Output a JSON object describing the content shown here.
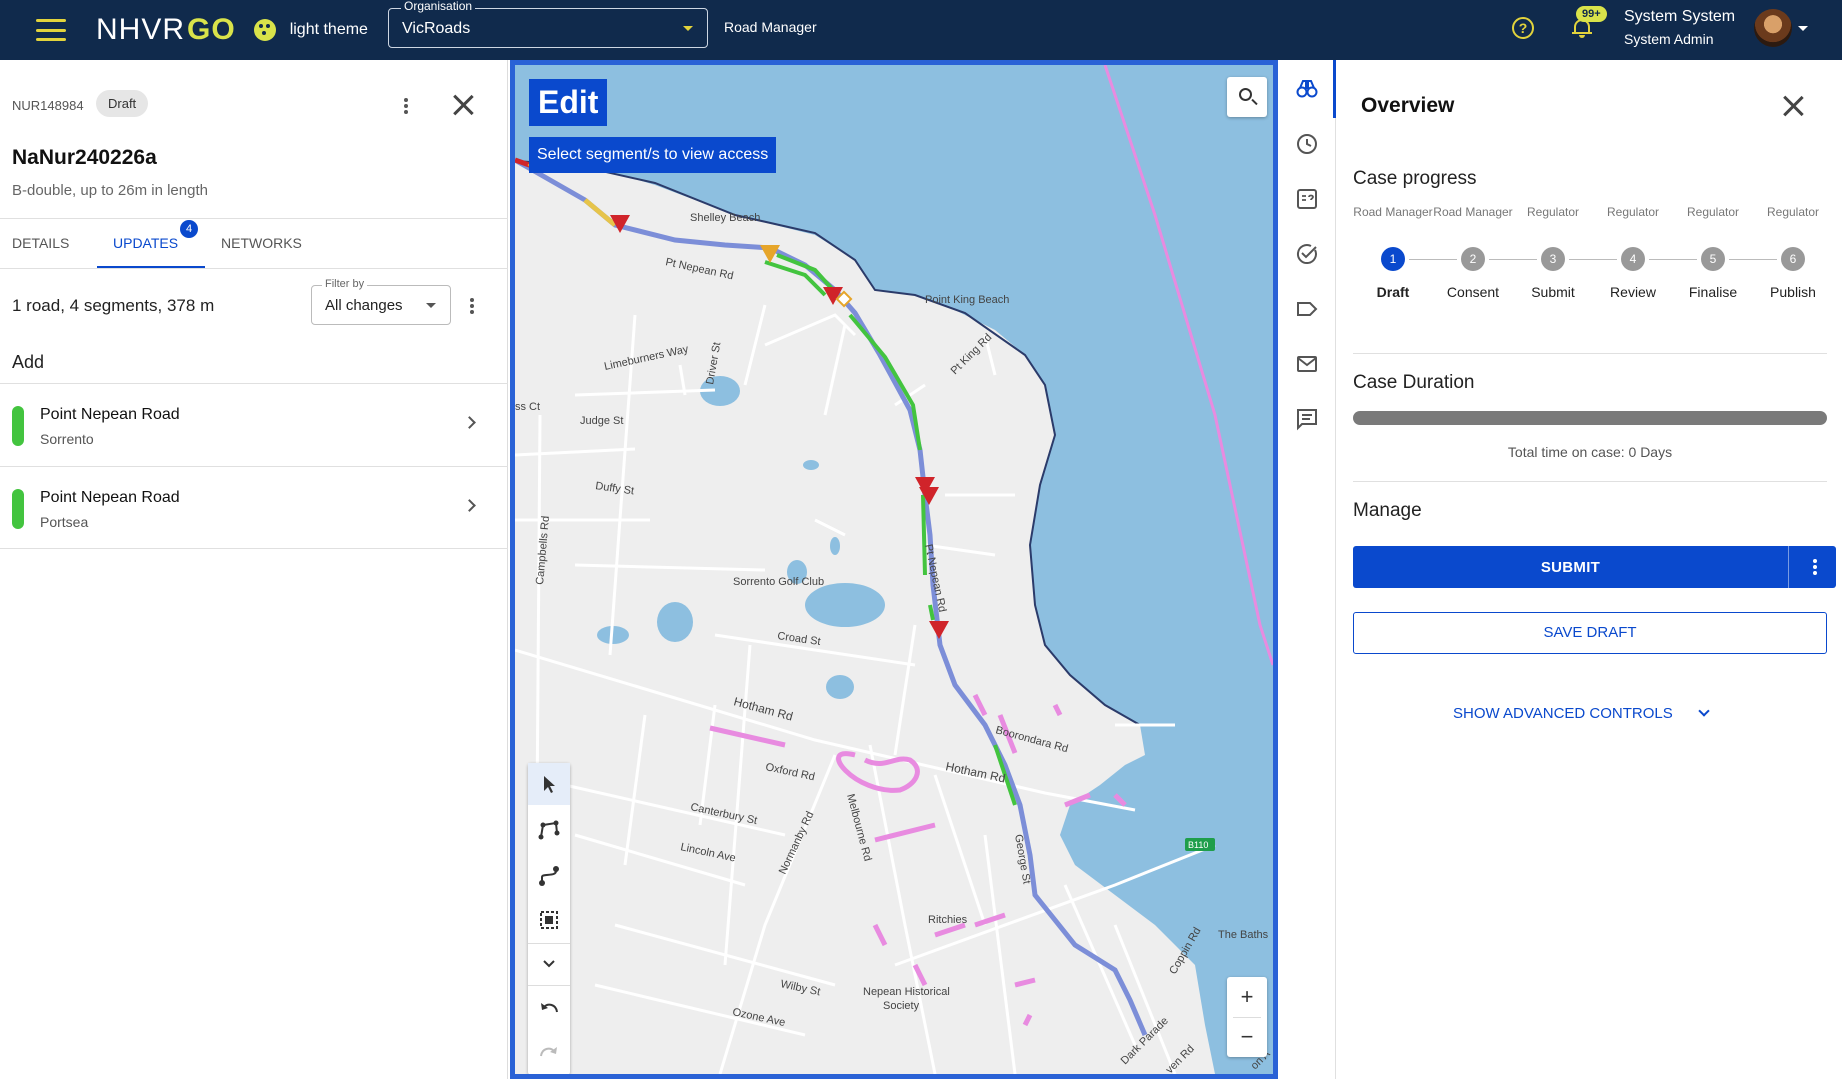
{
  "header": {
    "logo_main": "NHVR",
    "logo_accent": "GO",
    "theme_label": "light theme",
    "org_legend": "Organisation",
    "org_value": "VicRoads",
    "role": "Road Manager",
    "notif_count": "99+",
    "user_name": "System System",
    "user_role": "System Admin",
    "accent_color": "#e2d33c",
    "bg_color": "#102a4c"
  },
  "case": {
    "id": "NUR148984",
    "status": "Draft",
    "name": "NaNur240226a",
    "description": "B-double, up to 26m in length",
    "tabs": [
      {
        "label": "DETAILS"
      },
      {
        "label": "UPDATES",
        "badge": "4"
      },
      {
        "label": "NETWORKS"
      }
    ],
    "summary": "1 road, 4 segments, 378 m",
    "filter_legend": "Filter by",
    "filter_value": "All changes",
    "section": "Add",
    "items": [
      {
        "title": "Point Nepean Road",
        "subtitle": "Sorrento",
        "color": "#43c43f"
      },
      {
        "title": "Point Nepean Road",
        "subtitle": "Portsea",
        "color": "#43c43f"
      }
    ]
  },
  "map": {
    "edit_title": "Edit",
    "edit_subtitle": "Select segment/s to view access",
    "labels": {
      "shelley": "Shelley Beach",
      "ptnepean_rd": "Pt Nepean Rd",
      "pointking_beach": "Point King Beach",
      "limeburners": "Limeburners Way",
      "driver": "Driver St",
      "ptking_rd": "Pt King Rd",
      "ss_ct": "ss Ct",
      "judge": "Judge St",
      "duffy": "Duffy St",
      "campbells": "Campbells Rd",
      "golf": "Sorrento Golf Club",
      "ptnepean_rd2": "Pt Nepean Rd",
      "croad": "Croad St",
      "hotham": "Hotham Rd",
      "hotham2": "Hotham Rd",
      "boorondara": "Boorondara Rd",
      "oxford": "Oxford Rd",
      "canterbury": "Canterbury St",
      "lincoln": "Lincoln Ave",
      "normanby": "Normanby Rd",
      "melbourne": "Melbourne Rd",
      "george": "George St",
      "b110": "B110",
      "ritchies": "Ritchies",
      "baths": "The Baths",
      "coppin": "Coppin Rd",
      "wilby": "Wilby St",
      "ozone": "Ozone Ave",
      "historical1": "Nepean Historical",
      "historical2": "Society",
      "dark": "Dark Parade",
      "ven": "ven Rd",
      "on": "on A"
    },
    "zoom_in": "+",
    "zoom_out": "−"
  },
  "overview": {
    "title": "Overview",
    "case_progress": "Case progress",
    "steps": [
      {
        "role": "Road Manager",
        "num": "1",
        "label": "Draft",
        "active": true
      },
      {
        "role": "Road Manager",
        "num": "2",
        "label": "Consent",
        "active": false
      },
      {
        "role": "Regulator",
        "num": "3",
        "label": "Submit",
        "active": false
      },
      {
        "role": "Regulator",
        "num": "4",
        "label": "Review",
        "active": false
      },
      {
        "role": "Regulator",
        "num": "5",
        "label": "Finalise",
        "active": false
      },
      {
        "role": "Regulator",
        "num": "6",
        "label": "Publish",
        "active": false
      }
    ],
    "case_duration": "Case Duration",
    "duration_text": "Total time on case: 0 Days",
    "manage": "Manage",
    "submit_label": "SUBMIT",
    "save_draft_label": "SAVE DRAFT",
    "advanced_label": "SHOW ADVANCED CONTROLS",
    "primary_color": "#0a49cd"
  },
  "rail_icons": [
    "binoculars-icon",
    "history-icon",
    "quiz-icon",
    "check-circle-icon",
    "label-icon",
    "mail-icon",
    "comment-icon"
  ]
}
